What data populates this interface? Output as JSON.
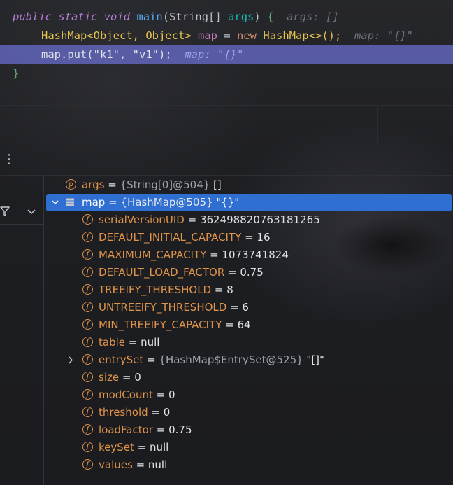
{
  "editor": {
    "line1": {
      "kw1": "public",
      "kw2": "static",
      "kw3": "void",
      "fn": "main",
      "open": "(",
      "type": "String[]",
      "param": "args",
      "close": ")",
      "brace": "{",
      "hint": "args: []"
    },
    "line2": {
      "type1": "HashMap",
      "gen": "<Object, Object>",
      "var": "map",
      "eq": "=",
      "kw": "new",
      "type2": "HashMap",
      "tail": "<>();",
      "hint": "map: \"{}\""
    },
    "line3": {
      "code_pre": "map.put(",
      "arg1": "\"k1\"",
      "comma": ", ",
      "arg2": "\"v1\"",
      "code_post": ");",
      "hint": "map: \"{}\""
    },
    "line4": {
      "brace": "}"
    }
  },
  "debugger": {
    "variables": [
      {
        "badge": "p",
        "name": "args",
        "eq": " = ",
        "ref": "{String[0]@504}",
        "value": " []",
        "expandable": false
      },
      {
        "badge": "list",
        "name": "map",
        "eq": " = ",
        "ref": "{HashMap@505}",
        "value": " \"{}\"",
        "expandable": true,
        "expanded": true,
        "selected": true
      },
      {
        "badge": "f",
        "name": "serialVersionUID",
        "eq": " = ",
        "ref": "",
        "value": "362498820763181265"
      },
      {
        "badge": "f",
        "name": "DEFAULT_INITIAL_CAPACITY",
        "eq": " = ",
        "ref": "",
        "value": "16"
      },
      {
        "badge": "f",
        "name": "MAXIMUM_CAPACITY",
        "eq": " = ",
        "ref": "",
        "value": "1073741824"
      },
      {
        "badge": "f",
        "name": "DEFAULT_LOAD_FACTOR",
        "eq": " = ",
        "ref": "",
        "value": "0.75"
      },
      {
        "badge": "f",
        "name": "TREEIFY_THRESHOLD",
        "eq": " = ",
        "ref": "",
        "value": "8"
      },
      {
        "badge": "f",
        "name": "UNTREEIFY_THRESHOLD",
        "eq": " = ",
        "ref": "",
        "value": "6"
      },
      {
        "badge": "f",
        "name": "MIN_TREEIFY_CAPACITY",
        "eq": " = ",
        "ref": "",
        "value": "64"
      },
      {
        "badge": "f",
        "name": "table",
        "eq": " = ",
        "ref": "",
        "value": "null"
      },
      {
        "badge": "f",
        "name": "entrySet",
        "eq": " = ",
        "ref": "{HashMap$EntrySet@525}",
        "value": " \"[]\"",
        "expandable": true
      },
      {
        "badge": "f",
        "name": "size",
        "eq": " = ",
        "ref": "",
        "value": "0"
      },
      {
        "badge": "f",
        "name": "modCount",
        "eq": " = ",
        "ref": "",
        "value": "0"
      },
      {
        "badge": "f",
        "name": "threshold",
        "eq": " = ",
        "ref": "",
        "value": "0"
      },
      {
        "badge": "f",
        "name": "loadFactor",
        "eq": " = ",
        "ref": "",
        "value": "0.75"
      },
      {
        "badge": "f",
        "name": "keySet",
        "eq": " = ",
        "ref": "",
        "value": "null"
      },
      {
        "badge": "f",
        "name": "values",
        "eq": " = ",
        "ref": "",
        "value": "null"
      }
    ]
  },
  "icons": {
    "more": "more-vertical-icon",
    "filter": "filter-icon",
    "chevron": "chevron-down-icon",
    "expand": "chevron-right-icon",
    "collapse": "chevron-down-icon"
  },
  "colors": {
    "selection": "#2e6fd1",
    "execution_line": "#6c70d2",
    "field_badge": "#e0944a"
  }
}
